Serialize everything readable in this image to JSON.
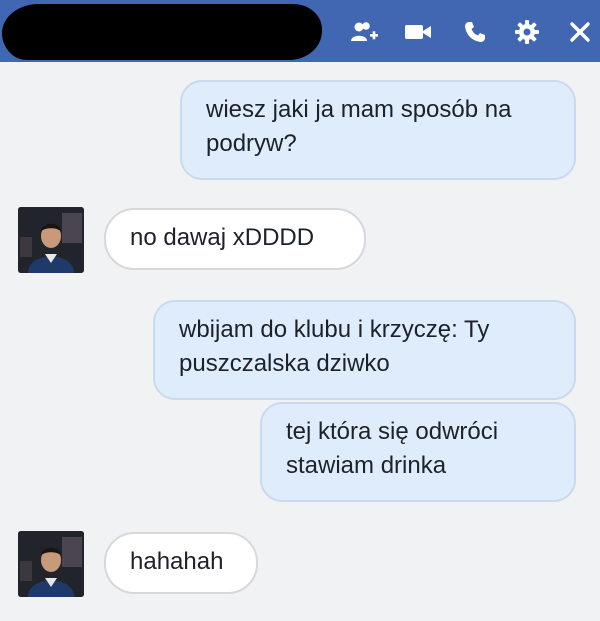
{
  "header": {
    "icons": [
      "add-people-icon",
      "video-call-icon",
      "phone-call-icon",
      "settings-gear-icon",
      "close-icon"
    ],
    "color": "#4267b2"
  },
  "messages": [
    {
      "side": "out",
      "text": "wiesz jaki ja mam sposób na podryw?"
    },
    {
      "side": "in",
      "text": "no dawaj xDDDD"
    },
    {
      "side": "out",
      "text": "wbijam do klubu i krzyczę: Ty puszczalska dziwko"
    },
    {
      "side": "out",
      "text": "tej która się odwróci stawiam drinka"
    },
    {
      "side": "in",
      "text": "hahahah"
    }
  ]
}
